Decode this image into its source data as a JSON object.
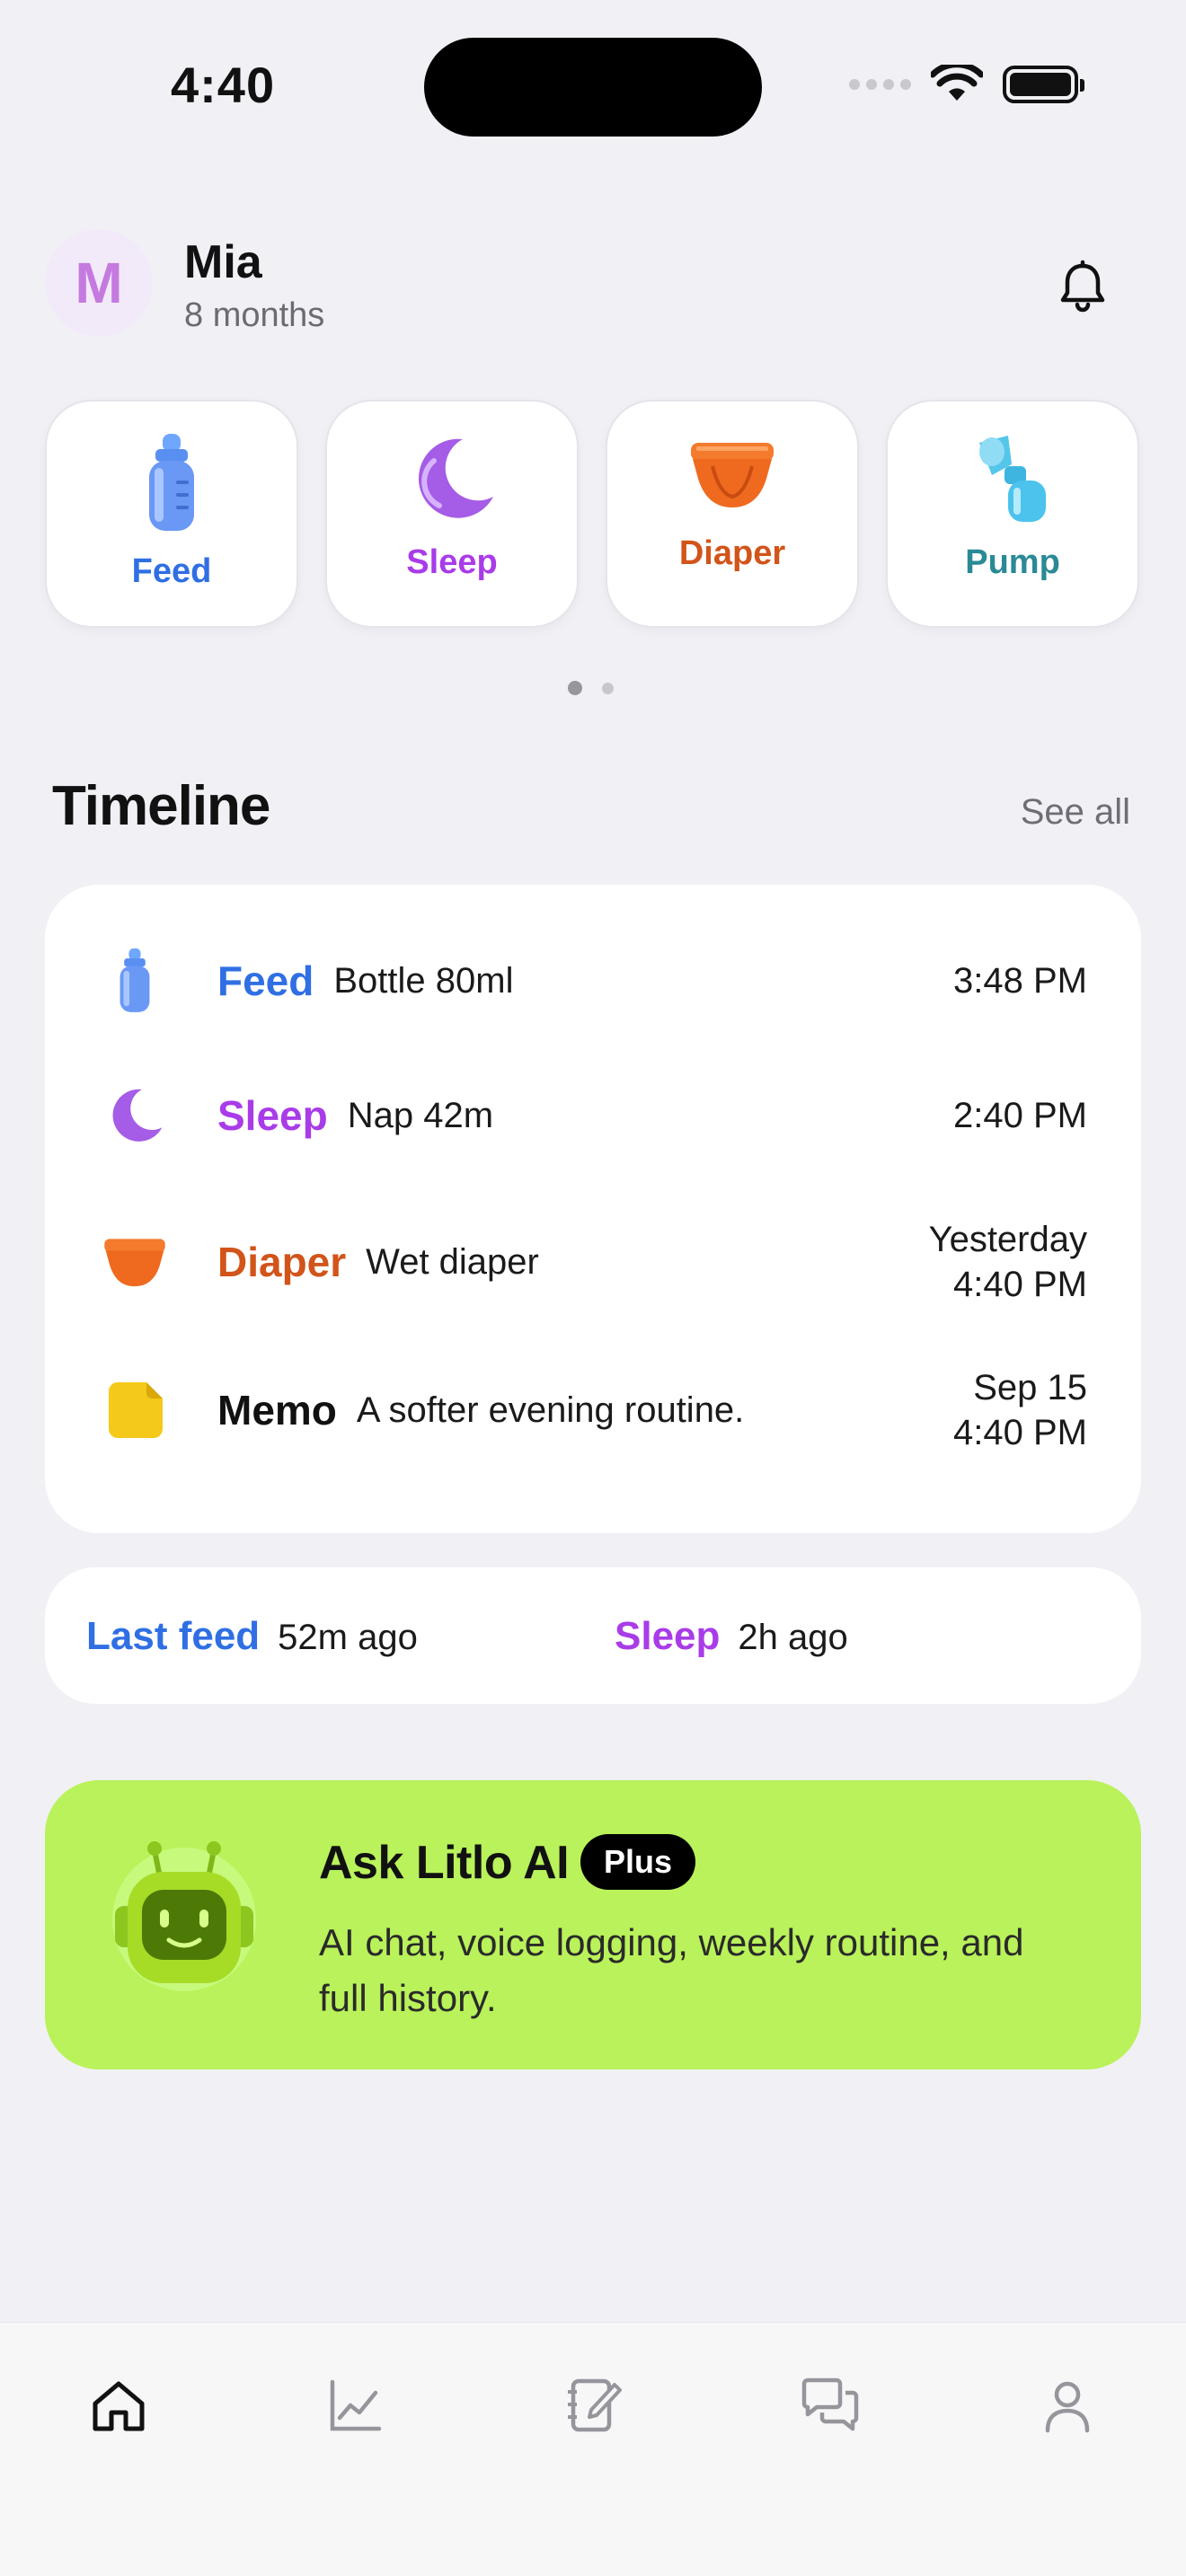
{
  "status_bar": {
    "time": "4:40"
  },
  "profile": {
    "initial": "M",
    "name": "Mia",
    "age": "8 months"
  },
  "quick_actions": [
    {
      "label": "Feed",
      "icon": "bottle-icon",
      "color": "#2f6fe3"
    },
    {
      "label": "Sleep",
      "icon": "moon-icon",
      "color": "#a93ce8"
    },
    {
      "label": "Diaper",
      "icon": "diaper-icon",
      "color": "#d2541a"
    },
    {
      "label": "Pump",
      "icon": "breast-pump-icon",
      "color": "#2a8a96"
    }
  ],
  "timeline": {
    "title": "Timeline",
    "see_all": "See all",
    "entries": [
      {
        "type": "Feed",
        "detail": "Bottle 80ml",
        "time_line1": "3:48 PM",
        "time_line2": "",
        "color": "#2f6fe3",
        "icon": "bottle-icon"
      },
      {
        "type": "Sleep",
        "detail": "Nap 42m",
        "time_line1": "2:40 PM",
        "time_line2": "",
        "color": "#a93ce8",
        "icon": "moon-icon"
      },
      {
        "type": "Diaper",
        "detail": "Wet diaper",
        "time_line1": "Yesterday",
        "time_line2": "4:40 PM",
        "color": "#d2541a",
        "icon": "diaper-icon"
      },
      {
        "type": "Memo",
        "detail": "A softer evening routine.",
        "time_line1": "Sep 15",
        "time_line2": "4:40 PM",
        "color": "#111111",
        "icon": "memo-icon"
      }
    ]
  },
  "summary": {
    "last_feed_label": "Last feed",
    "last_feed_value": "52m ago",
    "sleep_label": "Sleep",
    "sleep_value": "2h ago"
  },
  "ai_card": {
    "title": "Ask Litlo AI",
    "badge": "Plus",
    "description": "AI chat, voice logging, weekly routine, and full history."
  },
  "tabs": [
    {
      "name": "home",
      "icon": "home-icon",
      "active": true
    },
    {
      "name": "stats",
      "icon": "chart-icon",
      "active": false
    },
    {
      "name": "journal",
      "icon": "notebook-edit-icon",
      "active": false
    },
    {
      "name": "chat",
      "icon": "chat-bubbles-icon",
      "active": false
    },
    {
      "name": "profile",
      "icon": "person-icon",
      "active": false
    }
  ]
}
